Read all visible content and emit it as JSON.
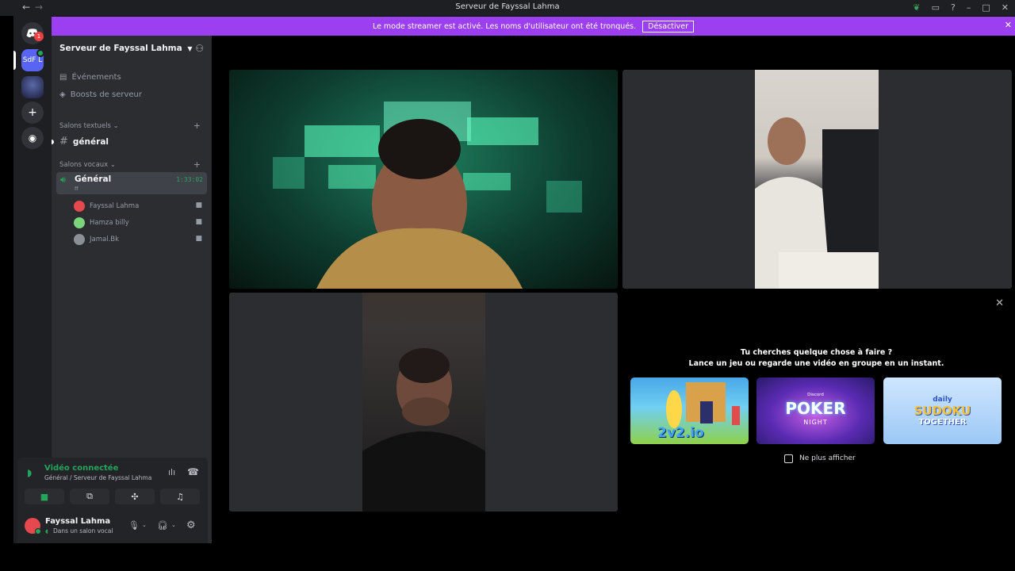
{
  "window": {
    "title": "Serveur de Fayssal Lahma",
    "back_glyph": "←",
    "forward_glyph": "→"
  },
  "banner": {
    "message": "Le mode streamer est activé. Les noms d'utilisateur ont été tronqués.",
    "button": "Désactiver"
  },
  "guilds": {
    "notification_count": "1",
    "server_abbr": "SdF L"
  },
  "sidebar": {
    "server_name": "Serveur de Fayssal Lahma",
    "events": "Événements",
    "boosts": "Boosts de serveur",
    "text_category": "Salons textuels",
    "text_channel": "général",
    "voice_category": "Salons vocaux",
    "voice_channel": "Général",
    "voice_subtitle": "ff",
    "voice_timer": "1:33:02",
    "members": [
      {
        "name": "Fayssal Lahma",
        "color": "#e5484d"
      },
      {
        "name": "Hamza billy",
        "color": "#7bd57b"
      },
      {
        "name": "Jamal.Bk",
        "color": "#8a8f98"
      }
    ]
  },
  "voice_panel": {
    "status": "Vidéo connectée",
    "location": "Général / Serveur de Fayssal Lahma"
  },
  "user_panel": {
    "name": "Fayssal Lahma",
    "status": "Dans un salon vocal"
  },
  "activity": {
    "heading": "Tu cherches quelque chose à faire ?",
    "subheading": "Lance un jeu ou regarde une vidéo en groupe en un instant.",
    "games": [
      {
        "title": "2v2.io",
        "icon": "game-2v2-icon"
      },
      {
        "brand": "Discord",
        "title": "POKER",
        "subtitle": "NIGHT",
        "icon": "game-poker-icon"
      },
      {
        "brand": "daily",
        "title": "SUDOKU",
        "subtitle": "TOGETHER",
        "icon": "game-sudoku-icon"
      }
    ],
    "dont_show": "Ne plus afficher"
  },
  "colors": {
    "accent": "#9b3ff0",
    "connected": "#23a55a",
    "blurple": "#5865f2"
  }
}
